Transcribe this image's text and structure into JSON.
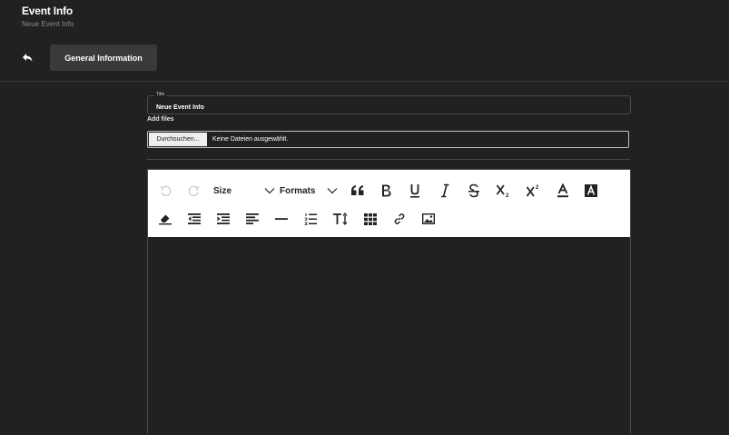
{
  "header": {
    "title": "Event Info",
    "subtitle": "Neue Event Info",
    "tab_general": "General Information"
  },
  "form": {
    "title_label": "Title",
    "title_value": "Neue Event Info",
    "add_files_label": "Add files",
    "browse_button": "Durchsuchen...",
    "file_status": "Keine Dateien ausgewählt."
  },
  "toolbar": {
    "size_label": "Size",
    "formats_label": "Formats",
    "row1_icons": [
      "undo-icon",
      "redo-icon",
      "size-dropdown",
      "formats-dropdown",
      "blockquote-icon",
      "bold-icon",
      "underline-icon",
      "italic-icon",
      "strikethrough-icon",
      "subscript-icon",
      "superscript-icon",
      "text-color-icon",
      "background-color-icon"
    ],
    "row2_icons": [
      "remove-format-icon",
      "outdent-icon",
      "indent-icon",
      "align-left-icon",
      "horizontal-rule-icon",
      "numbered-list-icon",
      "font-size-icon",
      "table-icon",
      "link-icon",
      "image-icon"
    ]
  },
  "colors": {
    "background": "#212121",
    "toolbar": "#ffffff",
    "tab_active": "#3a3a3a"
  }
}
